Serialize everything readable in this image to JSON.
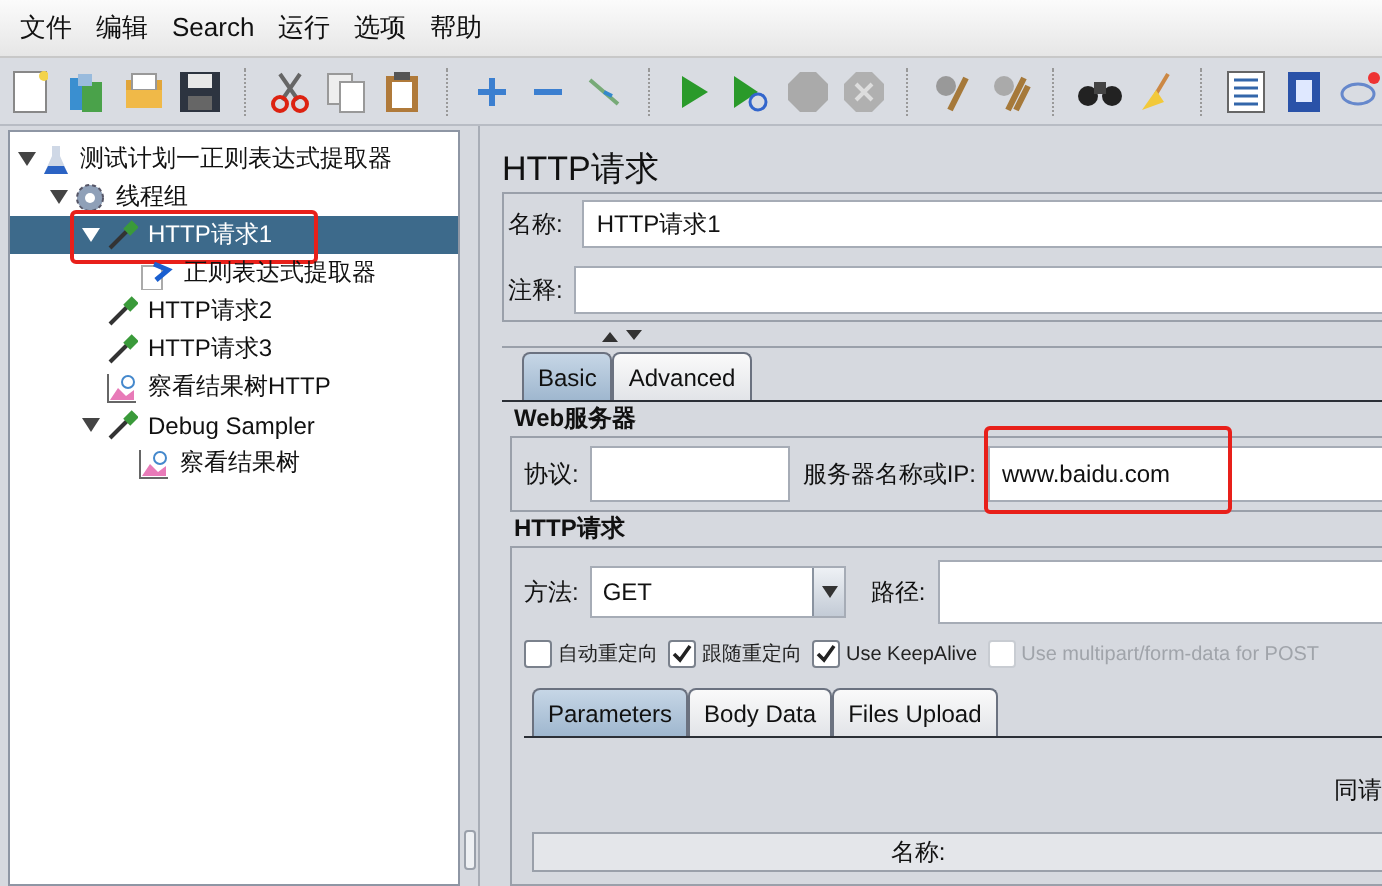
{
  "menu": [
    "文件",
    "编辑",
    "Search",
    "运行",
    "选项",
    "帮助"
  ],
  "tree": [
    {
      "label": "测试计划一正则表达式提取器",
      "kind": "plan",
      "expanded": true,
      "selected": false,
      "children": [
        {
          "label": "线程组",
          "kind": "threads",
          "expanded": true,
          "selected": false,
          "children": [
            {
              "label": "HTTP请求1",
              "kind": "sampler",
              "expanded": true,
              "selected": true,
              "annotated": true,
              "children": [
                {
                  "label": "正则表达式提取器",
                  "kind": "extractor",
                  "selected": false
                }
              ]
            },
            {
              "label": "HTTP请求2",
              "kind": "sampler",
              "selected": false
            },
            {
              "label": "HTTP请求3",
              "kind": "sampler",
              "selected": false
            },
            {
              "label": "察看结果树HTTP",
              "kind": "listener",
              "selected": false
            },
            {
              "label": "Debug Sampler",
              "kind": "sampler",
              "expanded": true,
              "selected": false,
              "children": [
                {
                  "label": "察看结果树",
                  "kind": "listener",
                  "selected": false
                }
              ]
            }
          ]
        }
      ]
    }
  ],
  "panel": {
    "title": "HTTP请求",
    "name_label": "名称:",
    "name_value": "HTTP请求1",
    "comment_label": "注释:",
    "tabs": [
      {
        "label": "Basic",
        "selected": true
      },
      {
        "label": "Advanced",
        "selected": false
      }
    ],
    "web_server": {
      "heading": "Web服务器",
      "protocol_label": "协议:",
      "server_label": "服务器名称或IP:",
      "server_value": "www.baidu.com",
      "server_annotated": true
    },
    "http_request": {
      "heading": "HTTP请求",
      "method_label": "方法:",
      "method_value": "GET",
      "path_label": "路径:",
      "options": [
        {
          "label": "自动重定向",
          "checked": false,
          "disabled": false
        },
        {
          "label": "跟随重定向",
          "checked": true,
          "disabled": false
        },
        {
          "label": "Use KeepAlive",
          "checked": true,
          "disabled": false
        },
        {
          "label": "Use multipart/form-data for POST",
          "checked": false,
          "disabled": true
        }
      ]
    },
    "subtabs": [
      {
        "label": "Parameters",
        "selected": true
      },
      {
        "label": "Body Data",
        "selected": false
      },
      {
        "label": "Files Upload",
        "selected": false
      }
    ],
    "cut_label": "同请",
    "table_header": "名称:"
  }
}
